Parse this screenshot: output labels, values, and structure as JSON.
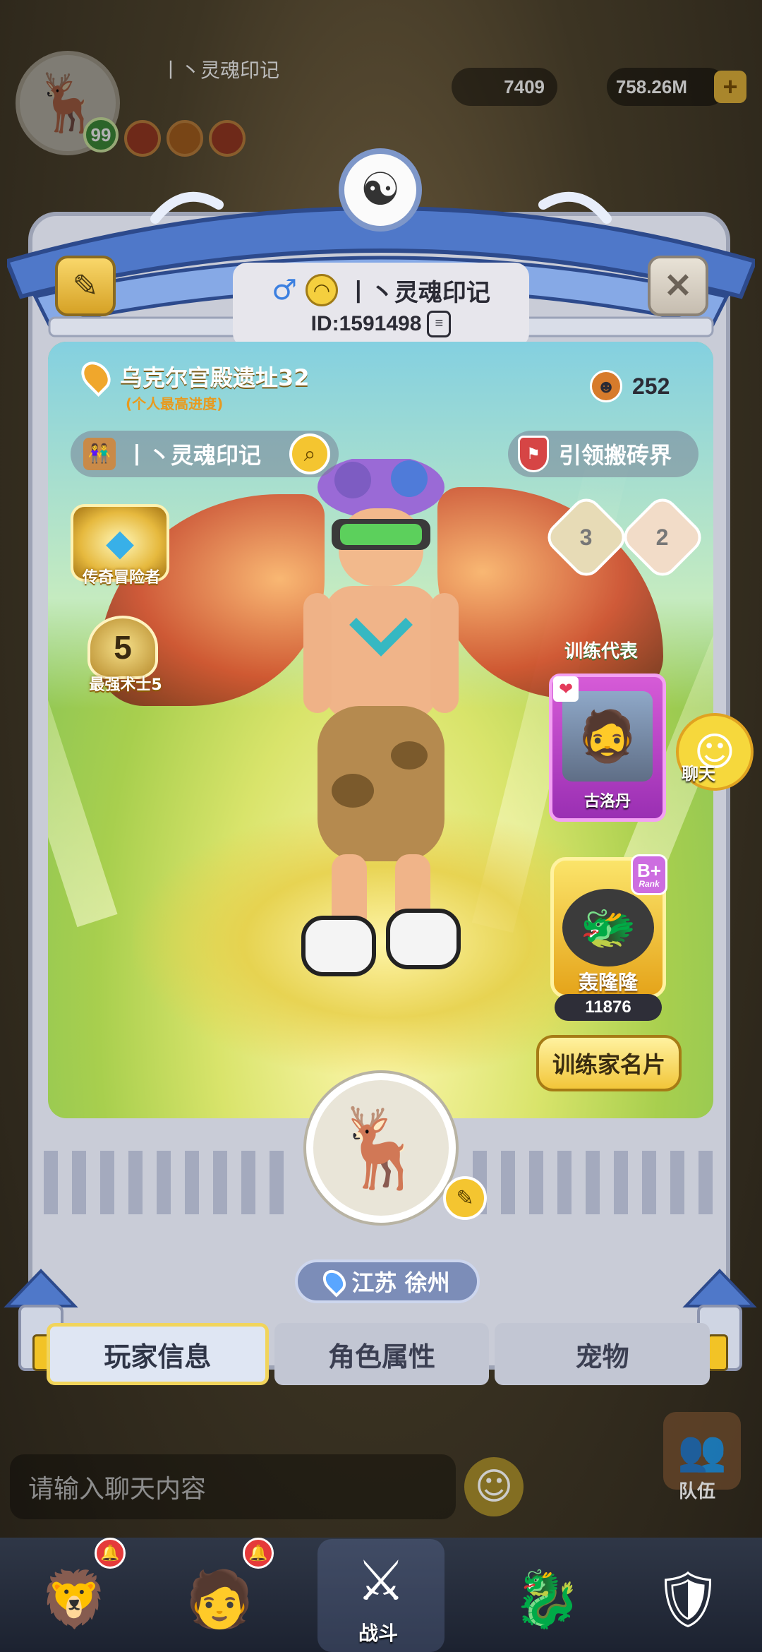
{
  "hud": {
    "player_name": "丨丶灵魂印记",
    "level": "99",
    "shells": "7409",
    "gems": "758.26M",
    "plus": "+"
  },
  "profile": {
    "gender": "♂",
    "name": "丨丶灵魂印记",
    "id": "ID:1591498",
    "location_name": "乌克尔宫殿遗址32",
    "location_sub": "(个人最高进度)",
    "likes": "252",
    "name_pill": "丨丶灵魂印记",
    "guild": "引领搬砖界",
    "medal_label": "传奇冒险者",
    "rank_number": "5",
    "rank_label": "最强术士5",
    "hex_badges": [
      "3",
      "2"
    ],
    "rep_title": "训练代表",
    "rep_card_name": "古洛丹",
    "pet_name": "轰隆隆",
    "pet_rank": "B+",
    "pet_rank_tag": "Rank",
    "pet_power": "11876",
    "trainer_card_button": "训练家名片",
    "side_chat_label": "聊天",
    "region": "江苏 徐州"
  },
  "tabs": [
    {
      "label": "玩家信息",
      "active": true
    },
    {
      "label": "角色属性",
      "active": false
    },
    {
      "label": "宠物",
      "active": false
    }
  ],
  "bottom": {
    "chat_placeholder": "请输入聊天内容",
    "team_label": "队伍",
    "battle_label": "战斗"
  },
  "colors": {
    "accent_gold": "#f2c63a",
    "frame": "#c9ccd7",
    "rep_card": "#b33fc8"
  },
  "icons": [
    "yin-yang-icon",
    "edit-profile-icon",
    "close-icon",
    "copy-icon",
    "location-pin-icon",
    "search-icon",
    "guild-icon",
    "heart-icon",
    "pencil-icon",
    "emoji-icon"
  ]
}
